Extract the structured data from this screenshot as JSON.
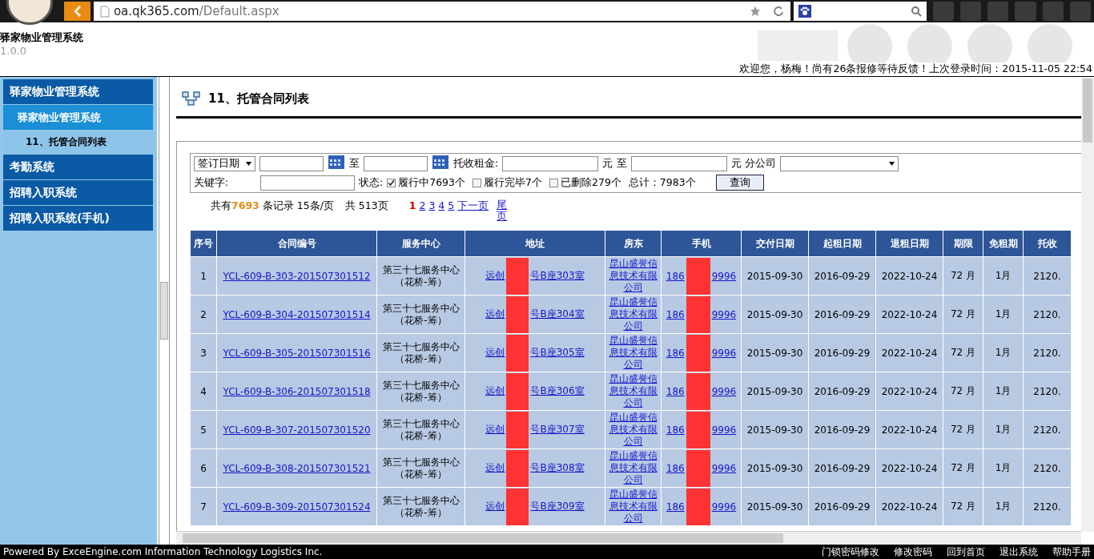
{
  "browser": {
    "url_host": "oa.qk365.com",
    "url_path": "/Default.aspx"
  },
  "header": {
    "title": "驿家物业管理系统",
    "version": "1.0.0",
    "welcome": "欢迎您，杨梅！尚有26条报修等待反馈！上次登录时间：2015-11-05 22:54"
  },
  "sidebar": {
    "items": [
      {
        "label": "驿家物业管理系统",
        "children": [
          {
            "label": "驿家物业管理系统",
            "children": [
              {
                "label": "11、托管合同列表"
              }
            ]
          }
        ]
      },
      {
        "label": "考勤系统"
      },
      {
        "label": "招聘入职系统"
      },
      {
        "label": "招聘入职系统(手机)"
      }
    ]
  },
  "page_title": "11、托管合同列表",
  "filters": {
    "date_type": "签订日期",
    "to_1": "至",
    "rent_label": "托收租金:",
    "unit_1": "元",
    "to_2": "至",
    "unit_2": "元 分公司",
    "keyword_label": "关键字:",
    "status_label": "状态:",
    "statuses": [
      {
        "label": "履行中7693个",
        "checked": true
      },
      {
        "label": "履行完毕7个",
        "checked": false
      },
      {
        "label": "已删除279个",
        "checked": false
      }
    ],
    "total": "总计：7983个",
    "search_button": "查询"
  },
  "pager": {
    "prefix": "共有",
    "count": "7693",
    "suffix": "条记录 15条/页",
    "pages": "共 513页",
    "page_links": [
      {
        "label": "1",
        "selected": true
      },
      {
        "label": "2",
        "selected": false
      },
      {
        "label": "3",
        "selected": false
      },
      {
        "label": "4",
        "selected": false
      },
      {
        "label": "5",
        "selected": false
      }
    ],
    "next": "下一页",
    "last": "尾页"
  },
  "table": {
    "columns": [
      "序号",
      "合同编号",
      "服务中心",
      "地址",
      "房东",
      "手机",
      "交付日期",
      "起租日期",
      "退租日期",
      "期限",
      "免租期",
      "托收"
    ],
    "rows": [
      {
        "index": "1",
        "contract_no": "YCL-609-B-303-201507301512",
        "center": "第三十七服务中心（花桥-筹）",
        "address_start": "远创",
        "address_end": "号B座303室",
        "landlord": "昆山盛誉信息技术有限公司",
        "phone_start": "186",
        "phone_end": "9996",
        "delivery": "2015-09-30",
        "start": "2016-09-29",
        "end": "2022-10-24",
        "term": "72 月",
        "free": "1月",
        "collect": "2120."
      },
      {
        "index": "2",
        "contract_no": "YCL-609-B-304-201507301514",
        "center": "第三十七服务中心（花桥-筹）",
        "address_start": "远创",
        "address_end": "号B座304室",
        "landlord": "昆山盛誉信息技术有限公司",
        "phone_start": "186",
        "phone_end": "9996",
        "delivery": "2015-09-30",
        "start": "2016-09-29",
        "end": "2022-10-24",
        "term": "72 月",
        "free": "1月",
        "collect": "2120."
      },
      {
        "index": "3",
        "contract_no": "YCL-609-B-305-201507301516",
        "center": "第三十七服务中心（花桥-筹）",
        "address_start": "远创",
        "address_end": "号B座305室",
        "landlord": "昆山盛誉信息技术有限公司",
        "phone_start": "186",
        "phone_end": "9996",
        "delivery": "2015-09-30",
        "start": "2016-09-29",
        "end": "2022-10-24",
        "term": "72 月",
        "free": "1月",
        "collect": "2120."
      },
      {
        "index": "4",
        "contract_no": "YCL-609-B-306-201507301518",
        "center": "第三十七服务中心（花桥-筹）",
        "address_start": "远创",
        "address_end": "号B座306室",
        "landlord": "昆山盛誉信息技术有限公司",
        "phone_start": "186",
        "phone_end": "9996",
        "delivery": "2015-09-30",
        "start": "2016-09-29",
        "end": "2022-10-24",
        "term": "72 月",
        "free": "1月",
        "collect": "2120."
      },
      {
        "index": "5",
        "contract_no": "YCL-609-B-307-201507301520",
        "center": "第三十七服务中心（花桥-筹）",
        "address_start": "远创",
        "address_end": "号B座307室",
        "landlord": "昆山盛誉信息技术有限公司",
        "phone_start": "186",
        "phone_end": "9996",
        "delivery": "2015-09-30",
        "start": "2016-09-29",
        "end": "2022-10-24",
        "term": "72 月",
        "free": "1月",
        "collect": "2120."
      },
      {
        "index": "6",
        "contract_no": "YCL-609-B-308-201507301521",
        "center": "第三十七服务中心（花桥-筹）",
        "address_start": "远创",
        "address_end": "号B座308室",
        "landlord": "昆山盛誉信息技术有限公司",
        "phone_start": "186",
        "phone_end": "9996",
        "delivery": "2015-09-30",
        "start": "2016-09-29",
        "end": "2022-10-24",
        "term": "72 月",
        "free": "1月",
        "collect": "2120."
      },
      {
        "index": "7",
        "contract_no": "YCL-609-B-309-201507301524",
        "center": "第三十七服务中心（花桥-筹）",
        "address_start": "远创",
        "address_end": "号B座309室",
        "landlord": "昆山盛誉信息技术有限公司",
        "phone_start": "186",
        "phone_end": "9996",
        "delivery": "2015-09-30",
        "start": "2016-09-29",
        "end": "2022-10-24",
        "term": "72 月",
        "free": "1月",
        "collect": "2120."
      }
    ]
  },
  "footer": {
    "powered": "Powered By ExceEngine.com Information Technology Logistics Inc.",
    "links": [
      "门锁密码修改",
      "修改密码",
      "回到首页",
      "退出系统",
      "帮助手册"
    ]
  }
}
